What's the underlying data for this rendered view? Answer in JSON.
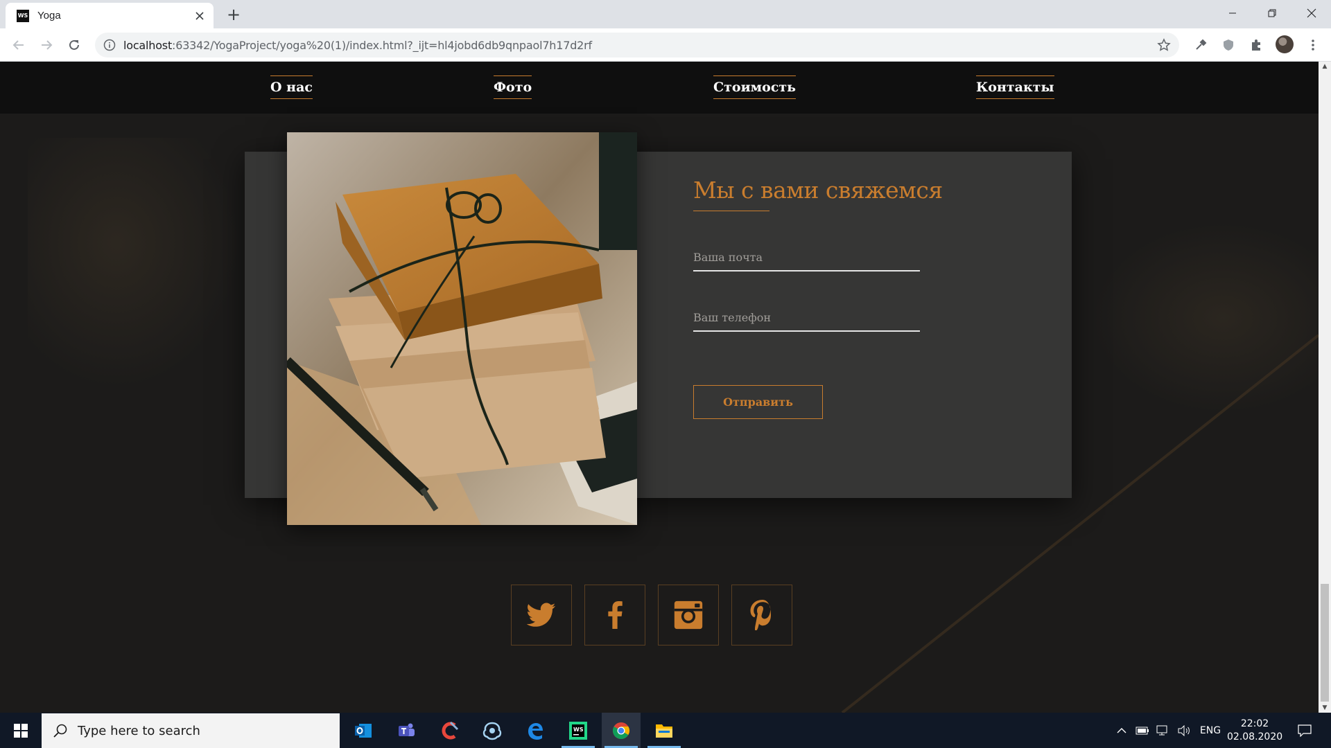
{
  "browser": {
    "tab_title": "Yoga",
    "tab_favicon_text": "WS",
    "url_host": "localhost",
    "url_rest": ":63342/YogaProject/yoga%20(1)/index.html?_ijt=hl4jobd6db9qnpaol7h17d2rf"
  },
  "site": {
    "nav": [
      "О нас",
      "Фото",
      "Стоимость",
      "Контакты"
    ],
    "contact": {
      "title": "Мы с вами свяжемся",
      "email_placeholder": "Ваша почта",
      "phone_placeholder": "Ваш телефон",
      "submit_label": "Отправить"
    },
    "social": [
      "twitter-icon",
      "facebook-icon",
      "instagram-icon",
      "pinterest-icon"
    ],
    "accent_color": "#c97d2e"
  },
  "taskbar": {
    "search_placeholder": "Type here to search",
    "lang": "ENG",
    "time": "22:02",
    "date": "02.08.2020"
  }
}
